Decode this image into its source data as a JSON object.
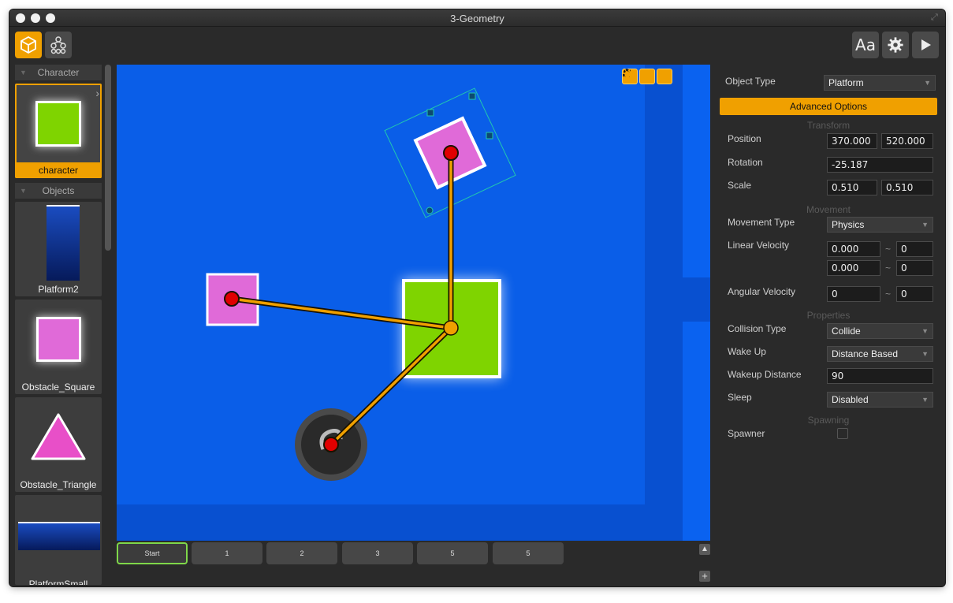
{
  "window": {
    "title": "3-Geometry"
  },
  "toolbar": {
    "objects_icon": "cube-icon",
    "hierarchy_icon": "hierarchy-icon",
    "font_label": "Aa",
    "settings_icon": "gear-icon",
    "play_icon": "play-icon"
  },
  "sidebar": {
    "character_header": "Character",
    "objects_header": "Objects",
    "character_item": {
      "label": "character",
      "color": "#7fd400"
    },
    "items": [
      {
        "label": "Platform2",
        "color": "#0a2a80"
      },
      {
        "label": "Obstacle_Square",
        "color": "#e06ad8"
      },
      {
        "label": "Obstacle_Triangle",
        "color": "#e84fc8"
      },
      {
        "label": "PlatformSmall",
        "color": "#0a3aa0"
      }
    ]
  },
  "canvas": {
    "background": "#0a5ee8",
    "tools": [
      "lock-icon",
      "rotate-icon",
      "resize-icon",
      "bug-icon",
      "arrow-right-icon"
    ]
  },
  "scenes": {
    "tabs": [
      "Start",
      "1",
      "2",
      "3",
      "5",
      "5"
    ],
    "active_index": 0
  },
  "properties": {
    "object_type_label": "Object Type",
    "object_type_value": "Platform",
    "advanced_options_label": "Advanced Options",
    "transform_title": "Transform",
    "position_label": "Position",
    "position_x": "370.000",
    "position_y": "520.000",
    "rotation_label": "Rotation",
    "rotation_value": "-25.187",
    "scale_label": "Scale",
    "scale_x": "0.510",
    "scale_y": "0.510",
    "movement_title": "Movement",
    "movement_type_label": "Movement Type",
    "movement_type_value": "Physics",
    "linear_velocity_label": "Linear Velocity",
    "linear_velocity_x_min": "0.000",
    "linear_velocity_x_max": "0",
    "linear_velocity_y_min": "0.000",
    "linear_velocity_y_max": "0",
    "angular_velocity_label": "Angular Velocity",
    "angular_velocity_min": "0",
    "angular_velocity_max": "0",
    "properties_title": "Properties",
    "collision_type_label": "Collision Type",
    "collision_type_value": "Collide",
    "wake_up_label": "Wake Up",
    "wake_up_value": "Distance Based",
    "wakeup_distance_label": "Wakeup Distance",
    "wakeup_distance_value": "90",
    "sleep_label": "Sleep",
    "sleep_value": "Disabled",
    "spawning_title": "Spawning",
    "spawner_label": "Spawner",
    "spawner_checked": false,
    "range_separator": "~"
  }
}
